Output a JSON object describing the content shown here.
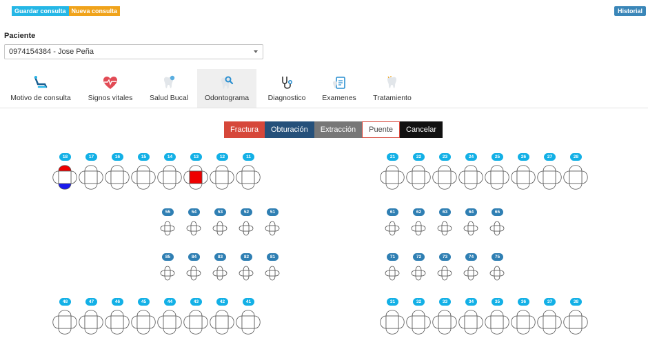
{
  "topbar": {
    "save_label": "Guardar consulta",
    "new_label": "Nueva consulta",
    "history_label": "Historial"
  },
  "patient": {
    "label": "Paciente",
    "selected": "0974154384 - Jose Peña"
  },
  "tabs": [
    {
      "label": "Motivo de consulta",
      "icon": "dental-chair-icon",
      "active": false
    },
    {
      "label": "Signos vitales",
      "icon": "heart-pulse-icon",
      "active": false
    },
    {
      "label": "Salud Bucal",
      "icon": "tooth-sparkle-icon",
      "active": false
    },
    {
      "label": "Odontograma",
      "icon": "tooth-search-icon",
      "active": true
    },
    {
      "label": "Diagnostico",
      "icon": "stethoscope-icon",
      "active": false
    },
    {
      "label": "Examenes",
      "icon": "clipboard-icon",
      "active": false
    },
    {
      "label": "Tratamiento",
      "icon": "tooth-icon",
      "active": false
    }
  ],
  "tools": [
    {
      "label": "Fractura"
    },
    {
      "label": "Obturación"
    },
    {
      "label": "Extracción"
    },
    {
      "label": "Puente"
    },
    {
      "label": "Cancelar"
    }
  ],
  "colors": {
    "fractura": "#d6473a",
    "obturacion": "#25507a",
    "extraccion": "#777777",
    "filled_red": "#ee0000",
    "filled_blue": "#1a1aee",
    "perm_badge": "#13b0e6",
    "temp_badge": "#2f7fb3"
  },
  "odontogram": {
    "upper_right": [
      "18",
      "17",
      "16",
      "15",
      "14",
      "13",
      "12",
      "11"
    ],
    "upper_left": [
      "21",
      "22",
      "23",
      "24",
      "25",
      "26",
      "27",
      "28"
    ],
    "temp_upper_right": [
      "55",
      "54",
      "53",
      "52",
      "51"
    ],
    "temp_upper_left": [
      "61",
      "62",
      "63",
      "64",
      "65"
    ],
    "temp_lower_right": [
      "85",
      "84",
      "83",
      "82",
      "81"
    ],
    "temp_lower_left": [
      "71",
      "72",
      "73",
      "74",
      "75"
    ],
    "lower_right": [
      "48",
      "47",
      "46",
      "45",
      "44",
      "43",
      "42",
      "41"
    ],
    "lower_left": [
      "31",
      "32",
      "33",
      "34",
      "35",
      "36",
      "37",
      "38"
    ],
    "marks": {
      "18": {
        "top": "red",
        "bottom": "blue"
      },
      "13": {
        "center": "red"
      }
    }
  }
}
